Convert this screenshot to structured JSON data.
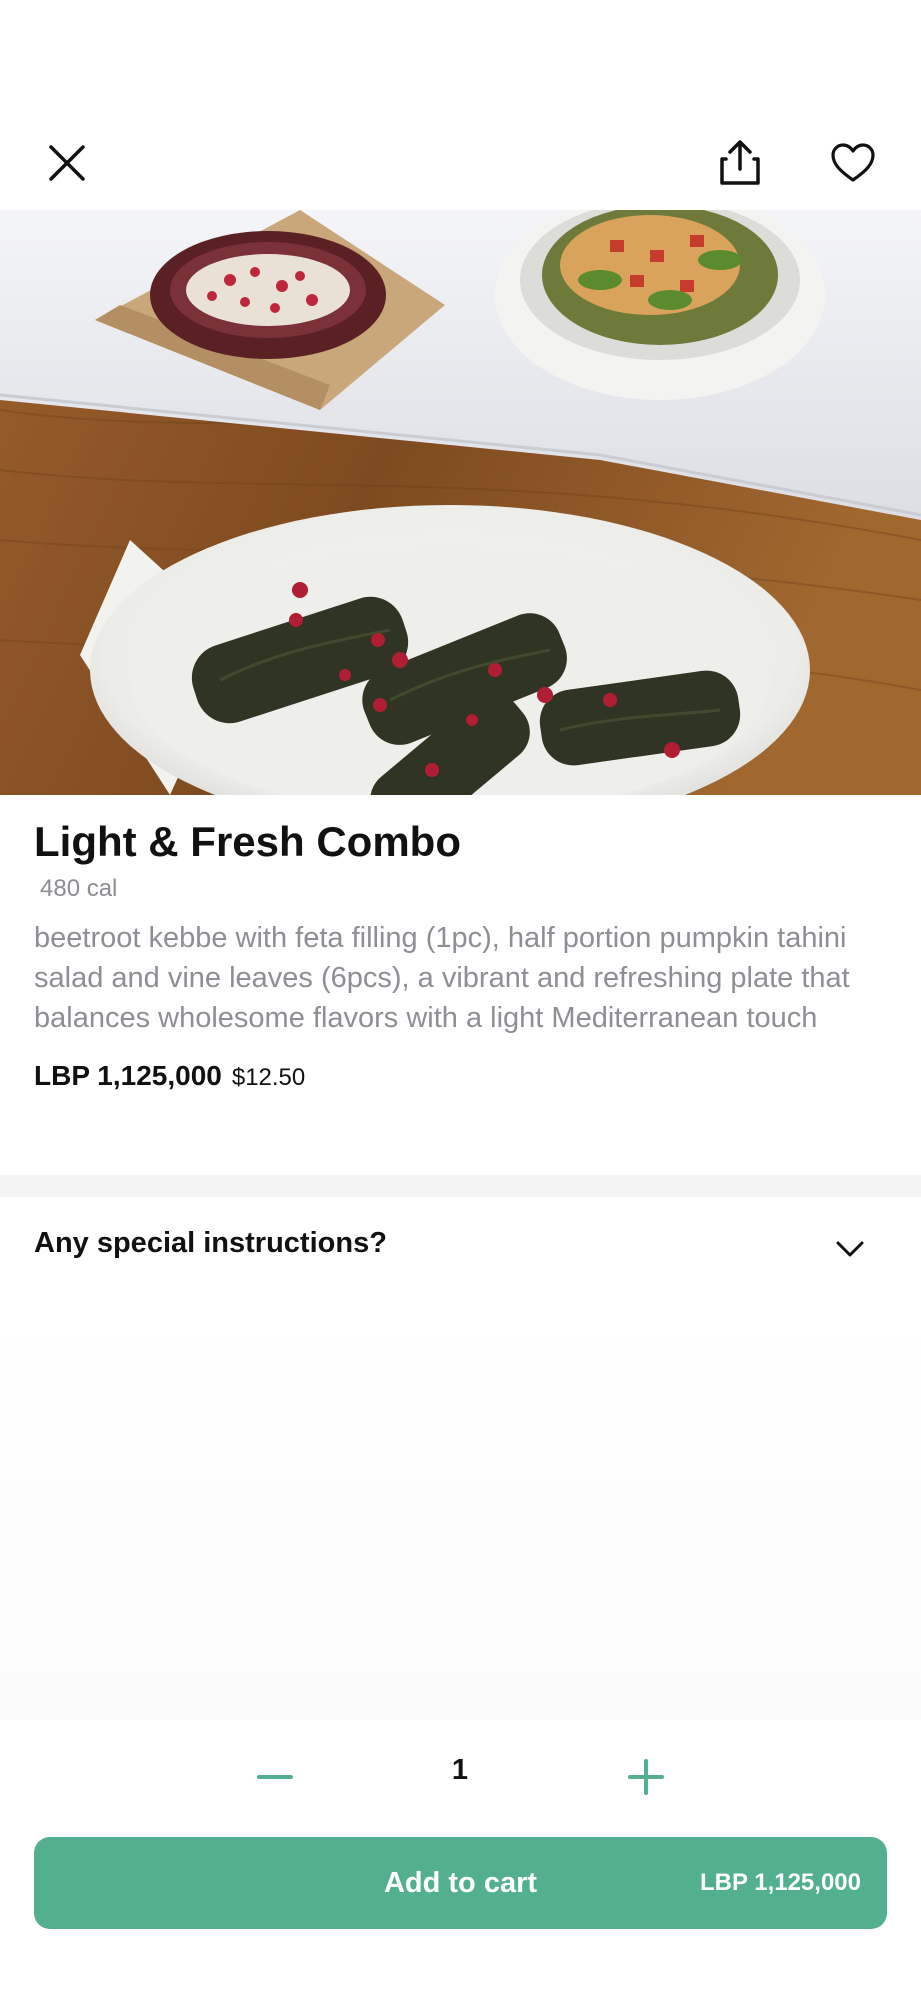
{
  "item": {
    "title": "Light & Fresh Combo",
    "calories": "480 cal",
    "description": "beetroot kebbe with feta filling (1pc), half portion pumpkin tahini salad and vine leaves (6pcs), a vibrant and refreshing plate that balances wholesome flavors with a light Mediterranean touch",
    "price_lbp": "LBP 1,125,000",
    "price_usd": "$12.50"
  },
  "instructions": {
    "label": "Any special instructions?"
  },
  "quantity": {
    "value": "1"
  },
  "cart": {
    "button_label": "Add to cart",
    "total": "LBP 1,125,000"
  },
  "icons": {
    "close": "close-icon",
    "share": "share-icon",
    "favorite": "heart-icon",
    "chevron": "chevron-down-icon",
    "minus": "minus-icon",
    "plus": "plus-icon"
  },
  "colors": {
    "accent": "#52b08e",
    "muted_text": "#8d8f95",
    "separator": "#f4f4f5"
  }
}
